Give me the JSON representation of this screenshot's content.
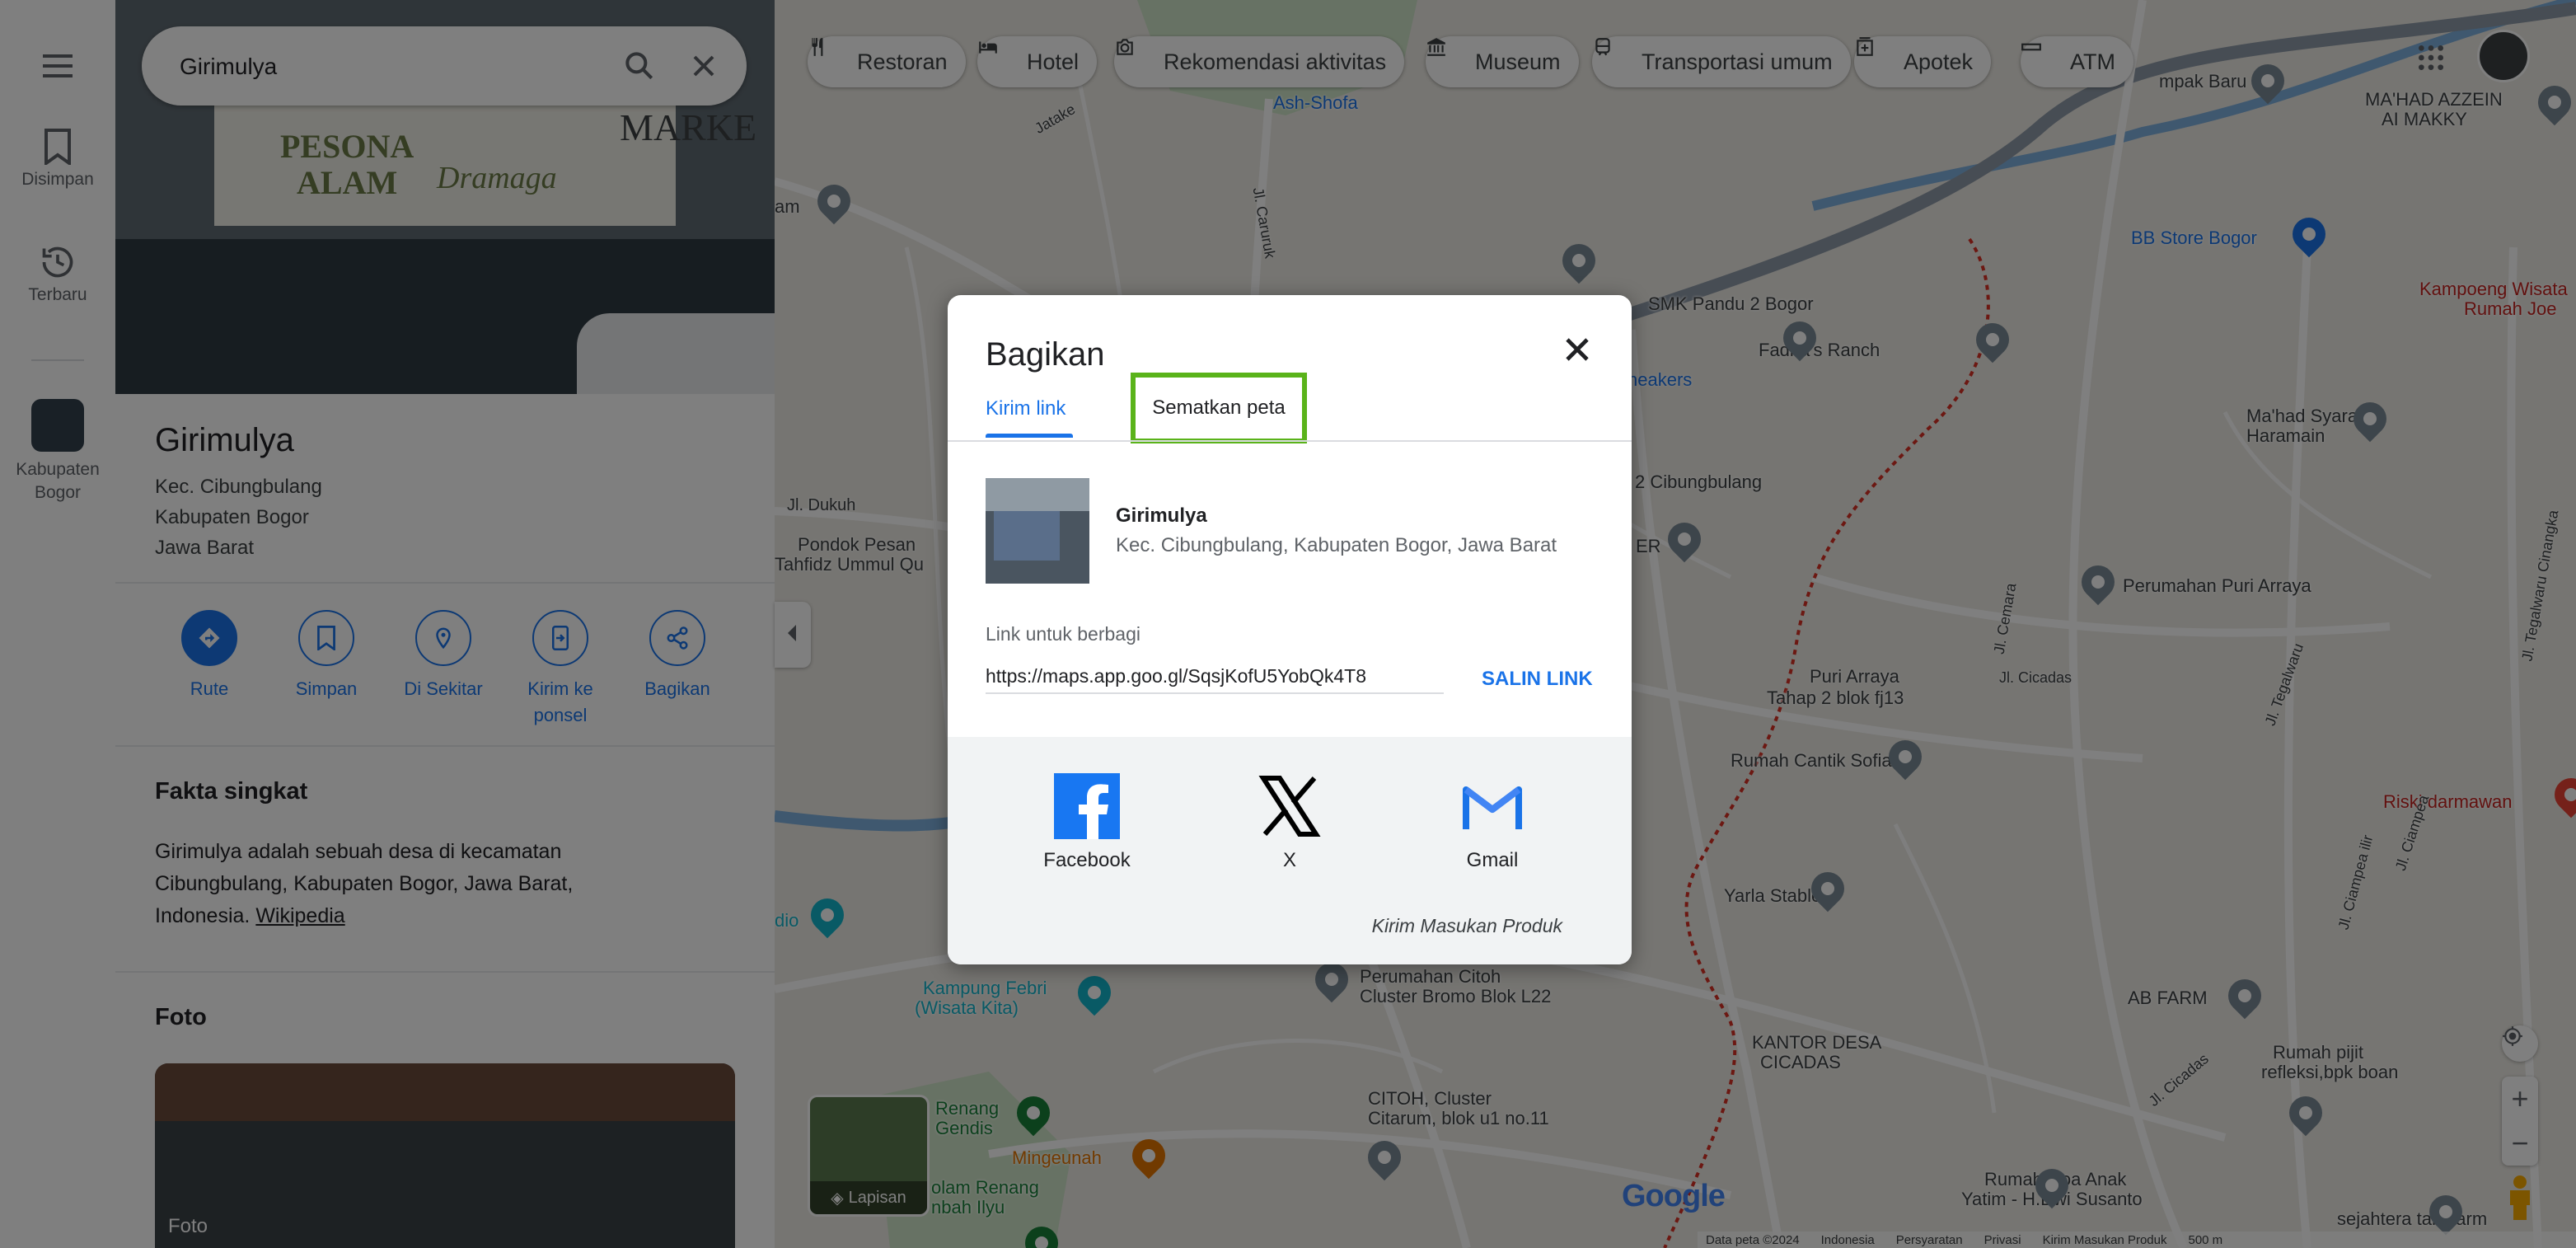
{
  "search": {
    "value": "Girimulya"
  },
  "rail": {
    "saved_label": "Disimpan",
    "recent_label": "Terbaru",
    "recent_place_label": "Kabupaten Bogor"
  },
  "photo_banner": {
    "line1": "PESONA",
    "line2": "ALAM",
    "line3": "Dramaga",
    "side": "MARKE"
  },
  "place": {
    "name": "Girimulya",
    "address_lines": [
      "Kec. Cibungbulang",
      "Kabupaten Bogor",
      "Jawa Barat"
    ]
  },
  "actions": [
    {
      "label": "Rute",
      "icon": "directions-icon"
    },
    {
      "label": "Simpan",
      "icon": "bookmark-icon"
    },
    {
      "label": "Di Sekitar",
      "icon": "nearby-icon"
    },
    {
      "label": "Kirim ke ponsel",
      "icon": "send-to-phone-icon"
    },
    {
      "label": "Bagikan",
      "icon": "share-icon"
    }
  ],
  "facts": {
    "heading": "Fakta singkat",
    "text": "Girimulya adalah sebuah desa di kecamatan Cibungbulang, Kabupaten Bogor, Jawa Barat, Indonesia.",
    "link": "Wikipedia"
  },
  "photos": {
    "heading": "Foto",
    "caption": "Foto"
  },
  "chips": [
    {
      "label": "Restoran",
      "icon": "restaurant-icon"
    },
    {
      "label": "Hotel",
      "icon": "hotel-icon"
    },
    {
      "label": "Rekomendasi aktivitas",
      "icon": "camera-icon"
    },
    {
      "label": "Museum",
      "icon": "museum-icon"
    },
    {
      "label": "Transportasi umum",
      "icon": "transit-icon"
    },
    {
      "label": "Apotek",
      "icon": "pharmacy-icon"
    },
    {
      "label": "ATM",
      "icon": "atm-icon"
    }
  ],
  "map_labels": [
    "Ash-Shofa",
    "Jl. Caruruk",
    "Jl. Dukuh",
    "Pondok Pesan",
    "Tahfidz Ummul Qu",
    "dio",
    "Kampung Febri",
    "(Wisata Kita)",
    "Perumahan Citoh",
    "Cluster Bromo Blok L22",
    "Renang",
    "Gendis",
    "Mingeunah",
    "CITOH, Cluster",
    "Citarum, blok u1 no.11",
    "olam Renang",
    "nbah Ilyu",
    "SMK Pandu 2 Bogor",
    "Fadira's Ranch",
    "neakers",
    "2 Cibungbulang",
    "ER",
    "BB Store Bogor",
    "Kampoeng Wisata",
    "Rumah Joe",
    "MA'HAD AZZEIN",
    "AI MAKKY",
    "mpak Baru",
    "Ma'had Syaraful",
    "Haramain",
    "Perumahan Puri Arraya",
    "Puri Arraya",
    "Tahap 2 blok fj13",
    "Rumah Cantik Sofia",
    "Jl. Cicadas",
    "Riski darmawan",
    "Yarla Stable",
    "AB FARM",
    "KANTOR DESA",
    "CICADAS",
    "Rumah pijit",
    "refleksi,bpk boan",
    "Rumah Doa Anak",
    "Yatim - H.Dwi Susanto",
    "sejahtera tani,farm",
    "am",
    "Jl. Ciampea",
    "Jl. Cemara",
    "Jl. Tegalwaru",
    "Jl. Tegalwaru Cinangka",
    "Jl. Ciampea ilir",
    "Jl. Cicadas",
    "Jatake"
  ],
  "layers": {
    "label": "Lapisan"
  },
  "google_logo": "Google",
  "footer": [
    "Data peta ©2024",
    "Indonesia",
    "Persyaratan",
    "Privasi",
    "Kirim Masukan Produk",
    "500 m"
  ],
  "dialog": {
    "title": "Bagikan",
    "tabs": [
      "Kirim link",
      "Sematkan peta"
    ],
    "place_name": "Girimulya",
    "place_address": "Kec. Cibungbulang, Kabupaten Bogor, Jawa Barat",
    "link_label": "Link untuk berbagi",
    "link_value": "https://maps.app.goo.gl/SqsjKofU5YobQk4T8",
    "copy_label": "SALIN LINK",
    "socials": [
      "Facebook",
      "X",
      "Gmail"
    ],
    "feedback": "Kirim Masukan Produk"
  },
  "colors": {
    "accent": "#1a73e8",
    "highlight_box": "#5ab31a",
    "overlay": "rgba(0,0,0,0.5)",
    "facebook": "#1877f2"
  }
}
